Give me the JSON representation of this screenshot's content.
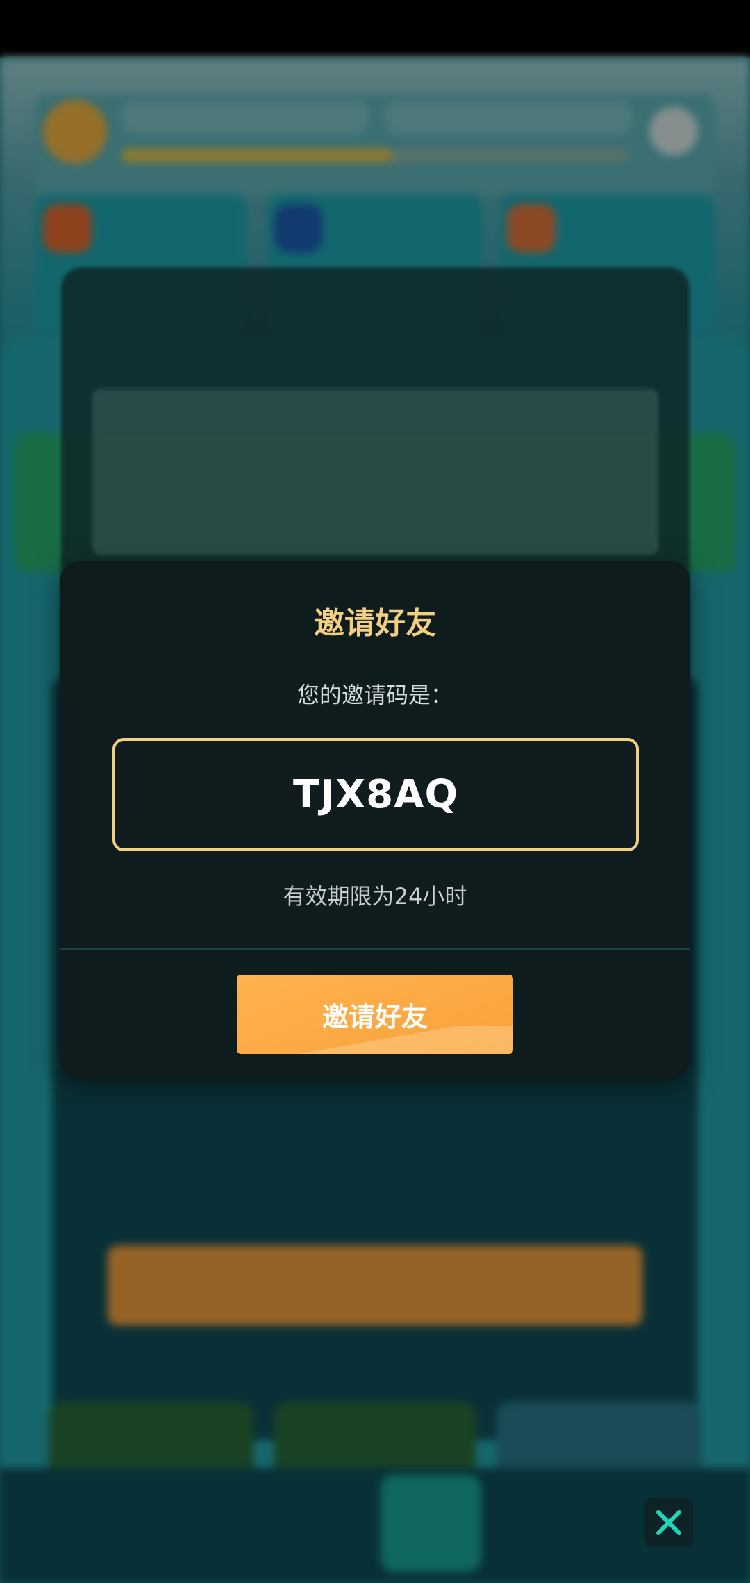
{
  "dialog": {
    "title": "邀请好友",
    "code_label": "您的邀请码是：",
    "code": "TJX8AQ",
    "validity": "有效期限为24小时",
    "button_label": "邀请好友"
  },
  "colors": {
    "accent_gold": "#f2cf83",
    "button_orange": "#f8a23c",
    "dialog_bg": "#0f1c1e",
    "close_icon": "#1fd6b8"
  },
  "icons": {
    "close": "close-icon"
  }
}
